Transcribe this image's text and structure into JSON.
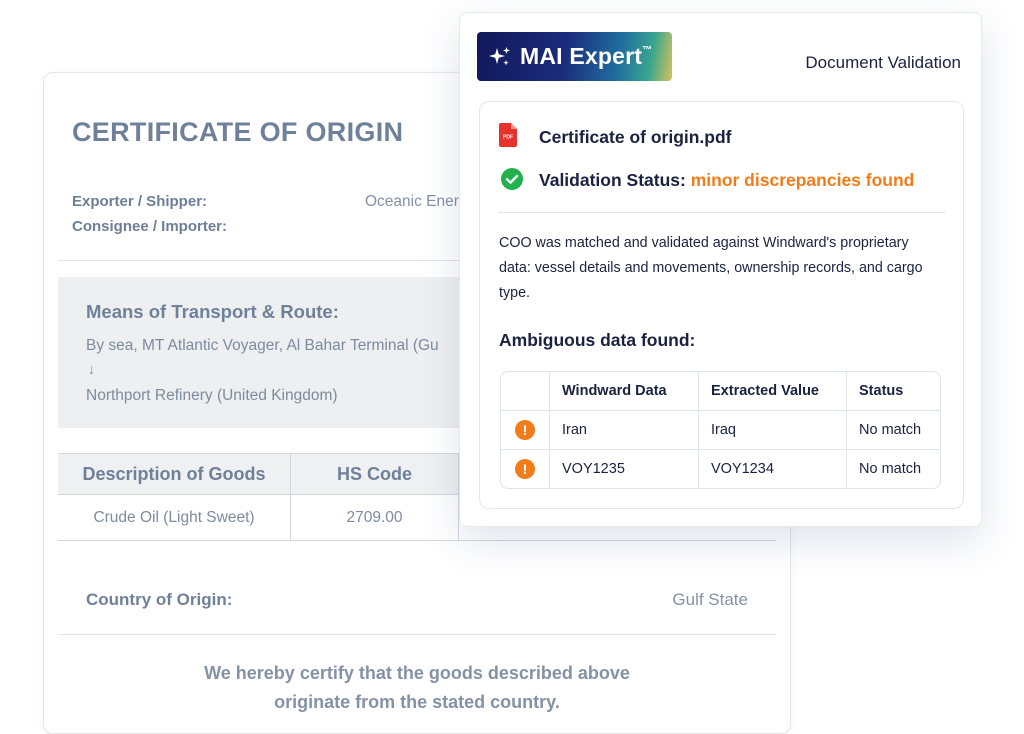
{
  "certificate": {
    "title": "CERTIFICATE OF ORIGIN",
    "exporter_label": "Exporter / Shipper:",
    "exporter_value": "Oceanic Ener",
    "consignee_label": "Consignee / Importer:",
    "route_title": "Means of Transport & Route:",
    "route_line1": "By sea, MT Atlantic Voyager, Al Bahar Terminal (Gu",
    "route_arrow": "↓",
    "route_line2": "Northport Refinery (United Kingdom)",
    "goods_headers": [
      "Description of Goods",
      "HS Code"
    ],
    "goods_rows": [
      {
        "description": "Crude Oil (Light Sweet)",
        "hs_code": "2709.00"
      }
    ],
    "origin_label": "Country of Origin:",
    "origin_value": "Gulf State",
    "certify_line1": "We hereby certify that the goods described above",
    "certify_line2": "originate from the stated country."
  },
  "panel": {
    "brand": "MAI Expert",
    "brand_tm": "™",
    "brand_icon": "sparkle-icon",
    "section_title": "Document Validation",
    "file_icon": "pdf-icon",
    "file_icon_label": "PDF",
    "file_name": "Certificate of origin.pdf",
    "status_icon": "check-circle-icon",
    "status_label": "Validation Status:",
    "status_value": "minor discrepancies found",
    "description": "COO was matched and validated against Windward's proprietary data: vessel details and movements, ownership records, and cargo type.",
    "ambiguous_title": "Ambiguous data found:",
    "table": {
      "headers": [
        "",
        "Windward Data",
        "Extracted Value",
        "Status"
      ],
      "rows": [
        {
          "icon": "warning-icon",
          "windward": "Iran",
          "extracted": "Iraq",
          "status": "No match"
        },
        {
          "icon": "warning-icon",
          "windward": "VOY1235",
          "extracted": "VOY1234",
          "status": "No match"
        }
      ]
    },
    "colors": {
      "status_accent": "#f07d1a",
      "check_green": "#22b14c",
      "pdf_red": "#e5322d",
      "text_dark": "#1a2240"
    }
  }
}
